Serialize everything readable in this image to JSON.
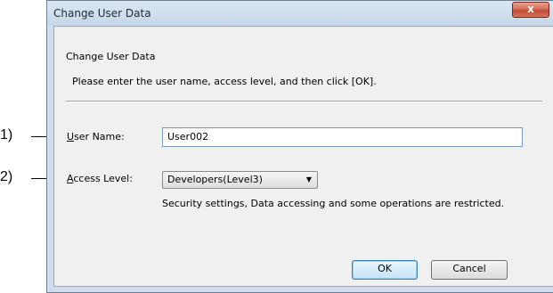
{
  "dialog": {
    "title": "Change User Data",
    "close_label": "x"
  },
  "header": {
    "title": "Change User Data",
    "description": "Please enter the user name, access level, and then click [OK]."
  },
  "form": {
    "user_name": {
      "label_accel": "U",
      "label_rest": "ser Name:",
      "value": "User002"
    },
    "access_level": {
      "label_accel": "A",
      "label_rest": "ccess Level:",
      "selected": "Developers(Level3)",
      "description": "Security settings, Data accessing and some operations are restricted."
    }
  },
  "buttons": {
    "ok": "OK",
    "cancel": "Cancel"
  },
  "callouts": {
    "one": "1)",
    "two": "2)"
  }
}
